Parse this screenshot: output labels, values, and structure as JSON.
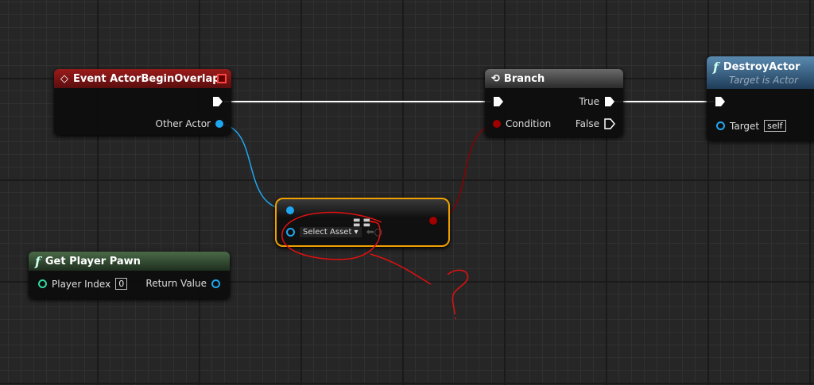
{
  "event_node": {
    "title": "Event ActorBeginOverlap",
    "pin_other_actor": "Other Actor"
  },
  "branch_node": {
    "title": "Branch",
    "pin_condition": "Condition",
    "pin_true": "True",
    "pin_false": "False"
  },
  "destroy_node": {
    "title": "DestroyActor",
    "subtitle": "Target is Actor",
    "pin_target": "Target",
    "target_value": "self"
  },
  "cast_node": {
    "select_asset": "Select Asset"
  },
  "player_pawn_node": {
    "title": "Get Player Pawn",
    "pin_player_index": "Player Index",
    "player_index_value": "0",
    "pin_return": "Return Value"
  },
  "colors": {
    "object_pin": "#1fa6f0",
    "bool_pin": "#a00000",
    "annotation": "#e01010",
    "selected": "#f0a000"
  }
}
